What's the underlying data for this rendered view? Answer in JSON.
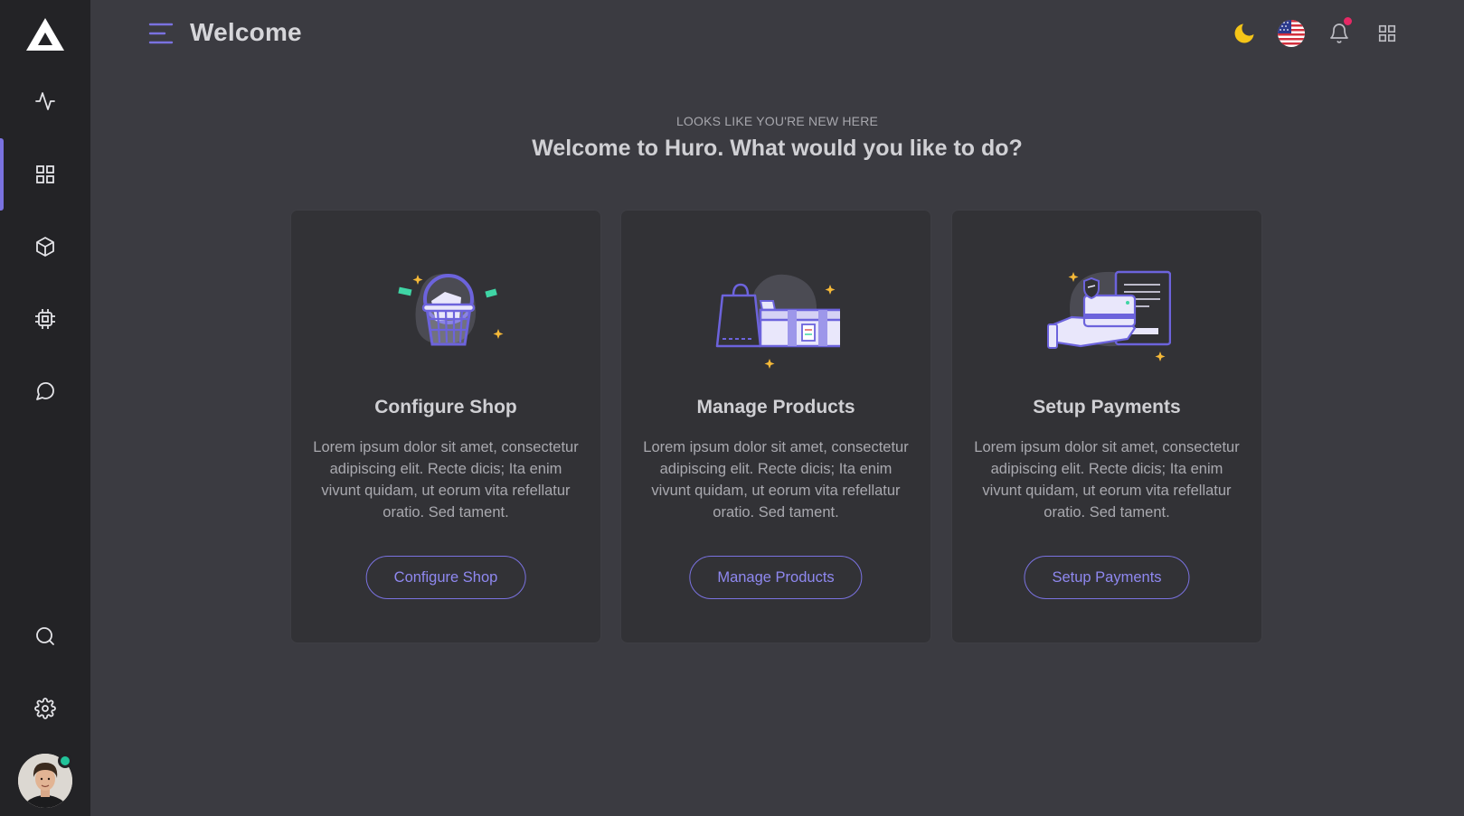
{
  "header": {
    "title": "Welcome"
  },
  "hero": {
    "subtitle": "LOOKS LIKE YOU'RE NEW HERE",
    "title": "Welcome to Huro. What would you like to do?"
  },
  "cards": [
    {
      "title": "Configure Shop",
      "text": "Lorem ipsum dolor sit amet, consectetur adipiscing elit. Recte dicis; Ita enim vivunt quidam, ut eorum vita refellatur oratio. Sed tament.",
      "button": "Configure Shop"
    },
    {
      "title": "Manage Products",
      "text": "Lorem ipsum dolor sit amet, consectetur adipiscing elit. Recte dicis; Ita enim vivunt quidam, ut eorum vita refellatur oratio. Sed tament.",
      "button": "Manage Products"
    },
    {
      "title": "Setup Payments",
      "text": "Lorem ipsum dolor sit amet, consectetur adipiscing elit. Recte dicis; Ita enim vivunt quidam, ut eorum vita refellatur oratio. Sed tament.",
      "button": "Setup Payments"
    }
  ],
  "sidebar": {
    "items": [
      {
        "icon": "activity-icon"
      },
      {
        "icon": "grid-icon",
        "active": true
      },
      {
        "icon": "box-icon"
      },
      {
        "icon": "cpu-icon"
      },
      {
        "icon": "message-icon"
      },
      {
        "icon": "search-icon"
      },
      {
        "icon": "settings-icon"
      }
    ]
  },
  "topbar_icons": [
    "moon-icon",
    "us-flag-icon",
    "bell-icon",
    "apps-grid-icon"
  ],
  "colors": {
    "accent": "#7a72e0",
    "background": "#3b3b41",
    "sidebar": "#232326",
    "card": "#323236",
    "online": "#22c39a",
    "notification": "#e62965",
    "moon": "#f5c518"
  }
}
